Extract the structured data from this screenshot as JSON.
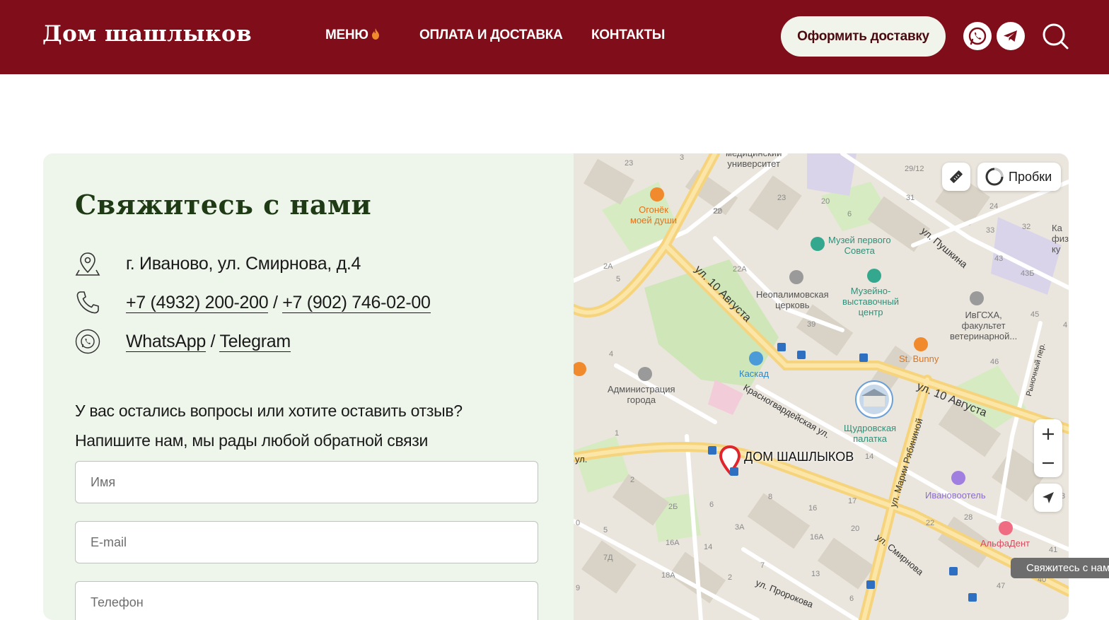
{
  "header": {
    "logo": "Дом шашлыков",
    "nav": [
      {
        "label": "МЕНЮ"
      },
      {
        "label": "ОПЛАТА И ДОСТАВКА"
      },
      {
        "label": "КОНТАКТЫ"
      }
    ],
    "cta_label": "Оформить доставку",
    "icons": [
      "whatsapp-icon",
      "telegram-icon",
      "search-icon"
    ],
    "colors": {
      "brand": "#7f0e1a",
      "cta_bg": "#f1f4ea"
    }
  },
  "contact": {
    "title": "Свяжитесь с нами",
    "address": "г. Иваново, ул. Смирнова, д.4",
    "phone1": "+7 (4932) 200-200",
    "phone_sep": " / ",
    "phone2": "+7 (902) 746-02-00",
    "messenger1": "WhatsApp",
    "messenger_sep": " / ",
    "messenger2": "Telegram",
    "question_line1": "У вас остались вопросы или хотите оставить отзыв?",
    "question_line2": "Напишите нам, мы рады любой обратной связи",
    "form": {
      "name_placeholder": "Имя",
      "email_placeholder": "E-mail",
      "phone_placeholder": "Телефон"
    },
    "colors": {
      "panel_bg": "#eef5ea",
      "title": "#1f3b16"
    }
  },
  "map": {
    "traffic_label": "Пробки",
    "pin_label": "ДОМ ШАШЛЫКОВ",
    "streets": {
      "avgusta_1": "ул. 10 Августа",
      "avgusta_2": "ул. 10 Августа",
      "pushkina": "ул. Пушкина",
      "krasnogvard": "Красногвардейская ул.",
      "rabininoy": "ул. Марии Рябининой",
      "smirnova": "ул. Смирнова",
      "prorokova": "ул. Пророкова",
      "rynochny": "Рыночный пер.",
      "ul_left": "ул."
    },
    "pois": {
      "ogonek": "Огонёк\nмоей души",
      "university": "медицинский\nуниверситет",
      "museum": "Музей первого\nСовета",
      "church": "Неопалимовская\nцерковь",
      "exhibition": "Музейно-\nвыставочный\nцентр",
      "ivgsha": "ИвГСХА,\nфакультет\nветеринарной...",
      "stbunny": "St. Bunny",
      "kaskad": "Каскад",
      "admin": "Администрация\nгорода",
      "shchudrov": "Щудровская\nпалатка",
      "ivanovohotel": "Ивановоотель",
      "alfadent": "АльфаДент",
      "kafiz": "Ка\nфиз\nку"
    },
    "numbers": [
      "23",
      "3",
      "20",
      "23",
      "20",
      "6",
      "29/12",
      "31",
      "24",
      "33",
      "32",
      "43",
      "43Б",
      "45",
      "22",
      "22А",
      "2А",
      "39",
      "4",
      "46",
      "1",
      "2",
      "2Б",
      "6",
      "8",
      "16",
      "17",
      "20",
      "22",
      "28",
      "41",
      "14",
      "3А",
      "16А",
      "16А",
      "14",
      "7Д",
      "18А",
      "5",
      "0",
      "9",
      "2",
      "7",
      "13",
      "47",
      "40",
      "6",
      "3",
      "4",
      "5"
    ]
  },
  "toast": {
    "label": "Свяжитесь с нами"
  }
}
